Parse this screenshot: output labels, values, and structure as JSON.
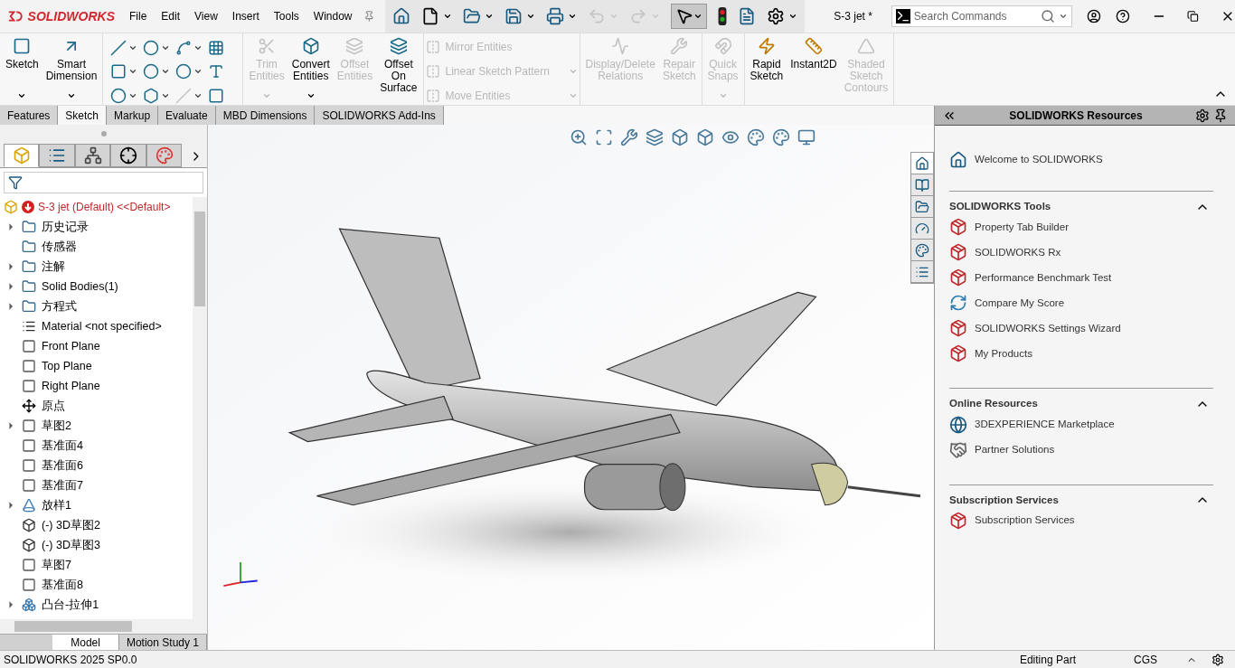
{
  "app": {
    "logo": "SOLIDWORKS",
    "menu": [
      "File",
      "Edit",
      "View",
      "Insert",
      "Tools",
      "Window"
    ],
    "document_title": "S-3 jet *",
    "search": {
      "placeholder": "Search Commands"
    }
  },
  "ribbon": {
    "groups": [
      {
        "kind": "large",
        "items": [
          {
            "lines": [
              "Sketch"
            ],
            "disabled": false,
            "dropdown": true
          },
          {
            "lines": [
              "Smart",
              "Dimension"
            ],
            "disabled": false,
            "dropdown": true
          }
        ]
      },
      {
        "kind": "grid"
      },
      {
        "kind": "large",
        "items": [
          {
            "lines": [
              "Trim",
              "Entities"
            ],
            "disabled": true,
            "dropdown": true
          },
          {
            "lines": [
              "Convert",
              "Entities"
            ],
            "disabled": false,
            "dropdown": true
          },
          {
            "lines": [
              "Offset",
              "Entities"
            ],
            "disabled": true,
            "dropdown": false
          },
          {
            "lines": [
              "Offset",
              "On",
              "Surface"
            ],
            "disabled": false,
            "dropdown": false
          }
        ]
      },
      {
        "kind": "small",
        "items": [
          {
            "label": "Mirror Entities",
            "disabled": true,
            "dropdown": false
          },
          {
            "label": "Linear Sketch Pattern",
            "disabled": true,
            "dropdown": true
          },
          {
            "label": "Move Entities",
            "disabled": true,
            "dropdown": true
          }
        ]
      },
      {
        "kind": "large",
        "items": [
          {
            "lines": [
              "Display/Delete",
              "Relations"
            ],
            "disabled": true,
            "dropdown": false
          },
          {
            "lines": [
              "Repair",
              "Sketch"
            ],
            "disabled": true,
            "dropdown": false
          }
        ]
      },
      {
        "kind": "large",
        "items": [
          {
            "lines": [
              "Quick",
              "Snaps"
            ],
            "disabled": true,
            "dropdown": true
          }
        ]
      },
      {
        "kind": "large",
        "items": [
          {
            "lines": [
              "Rapid",
              "Sketch"
            ],
            "disabled": false,
            "dropdown": false
          },
          {
            "lines": [
              "Instant2D"
            ],
            "disabled": false,
            "dropdown": false
          },
          {
            "lines": [
              "Shaded",
              "Sketch",
              "Contours"
            ],
            "disabled": true,
            "dropdown": false
          }
        ]
      }
    ]
  },
  "command_tabs": [
    {
      "label": "Features",
      "selected": false
    },
    {
      "label": "Sketch",
      "selected": true
    },
    {
      "label": "Markup",
      "selected": false
    },
    {
      "label": "Evaluate",
      "selected": false
    },
    {
      "label": "MBD Dimensions",
      "selected": false
    },
    {
      "label": "SOLIDWORKS Add-Ins",
      "selected": false
    }
  ],
  "panel_tabs": [
    {
      "selected": true
    },
    {
      "selected": false
    },
    {
      "selected": false
    },
    {
      "selected": false
    },
    {
      "selected": false
    }
  ],
  "feature_tree": {
    "root": "S-3 jet (Default) <<Default>",
    "items": [
      {
        "label": "历史记录",
        "kind": "folder",
        "expandable": true
      },
      {
        "label": "传感器",
        "kind": "folder",
        "expandable": false
      },
      {
        "label": "注解",
        "kind": "folder",
        "expandable": true
      },
      {
        "label": "Solid Bodies(1)",
        "kind": "folder",
        "expandable": true
      },
      {
        "label": "方程式",
        "kind": "folder",
        "expandable": true
      },
      {
        "label": "Material <not specified>",
        "kind": "material",
        "expandable": false
      },
      {
        "label": "Front Plane",
        "kind": "plane",
        "expandable": false
      },
      {
        "label": "Top Plane",
        "kind": "plane",
        "expandable": false
      },
      {
        "label": "Right Plane",
        "kind": "plane",
        "expandable": false
      },
      {
        "label": "原点",
        "kind": "origin",
        "expandable": false
      },
      {
        "label": "草图2",
        "kind": "sketch",
        "expandable": true
      },
      {
        "label": "基准面4",
        "kind": "plane",
        "expandable": false
      },
      {
        "label": "基准面6",
        "kind": "plane",
        "expandable": false
      },
      {
        "label": "基准面7",
        "kind": "plane",
        "expandable": false
      },
      {
        "label": "放样1",
        "kind": "loft",
        "expandable": true
      },
      {
        "label": "(-) 3D草图2",
        "kind": "sketch3d",
        "expandable": false
      },
      {
        "label": "(-) 3D草图3",
        "kind": "sketch3d",
        "expandable": false
      },
      {
        "label": "草图7",
        "kind": "sketch",
        "expandable": false
      },
      {
        "label": "基准面8",
        "kind": "plane",
        "expandable": false
      },
      {
        "label": "凸台-拉伸1",
        "kind": "extrude",
        "expandable": true
      }
    ]
  },
  "bottom_tabs": [
    {
      "label": "Model",
      "selected": true
    },
    {
      "label": "Motion Study 1",
      "selected": false
    }
  ],
  "task_pane_tabs": [
    {
      "selected": true
    },
    {
      "selected": false
    },
    {
      "selected": false
    },
    {
      "selected": false
    },
    {
      "selected": false
    },
    {
      "selected": false
    }
  ],
  "task_pane": {
    "title": "SOLIDWORKS Resources",
    "welcome": "Welcome to SOLIDWORKS",
    "sections": [
      {
        "title": "SOLIDWORKS Tools",
        "expanded": true,
        "items": [
          {
            "label": "Property Tab Builder"
          },
          {
            "label": "SOLIDWORKS Rx"
          },
          {
            "label": "Performance Benchmark Test"
          },
          {
            "label": "Compare My Score"
          },
          {
            "label": "SOLIDWORKS Settings Wizard"
          },
          {
            "label": "My Products"
          }
        ]
      },
      {
        "title": "Online Resources",
        "expanded": true,
        "items": [
          {
            "label": "3DEXPERIENCE Marketplace"
          },
          {
            "label": "Partner Solutions"
          }
        ]
      },
      {
        "title": "Subscription Services",
        "expanded": true,
        "items": [
          {
            "label": "Subscription Services"
          }
        ]
      }
    ]
  },
  "status_bar": {
    "version": "SOLIDWORKS 2025 SP0.0",
    "mode": "Editing Part",
    "units": "CGS"
  }
}
